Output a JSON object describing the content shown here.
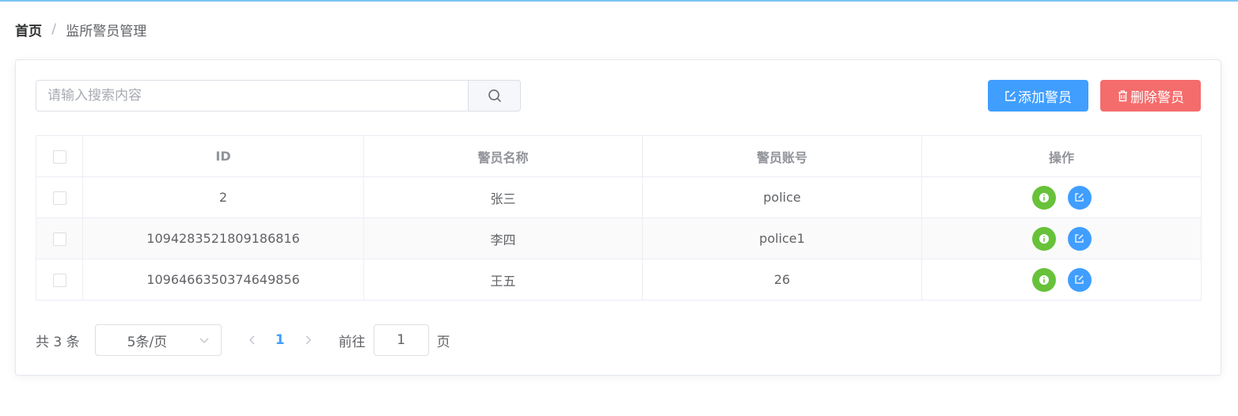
{
  "breadcrumb": {
    "home": "首页",
    "separator": "/",
    "current": "监所警员管理"
  },
  "toolbar": {
    "search_placeholder": "请输入搜索内容",
    "add_label": "添加警员",
    "delete_label": "删除警员"
  },
  "table": {
    "headers": {
      "id": "ID",
      "name": "警员名称",
      "account": "警员账号",
      "actions": "操作"
    },
    "rows": [
      {
        "id": "2",
        "name": "张三",
        "account": "police"
      },
      {
        "id": "1094283521809186816",
        "name": "李四",
        "account": "police1"
      },
      {
        "id": "1096466350374649856",
        "name": "王五",
        "account": "26"
      }
    ]
  },
  "pagination": {
    "total": "共 3 条",
    "page_size": "5条/页",
    "current_page": "1",
    "goto_label": "前往",
    "goto_value": "1",
    "goto_suffix": "页"
  },
  "colors": {
    "primary": "#409eff",
    "danger": "#f56c6c",
    "success": "#67c23a"
  },
  "icons": {
    "search": "search-icon",
    "add": "edit-icon",
    "delete": "trash-icon",
    "detail": "info-icon",
    "edit": "edit-icon",
    "dropdown": "chevron-down-icon",
    "prev": "chevron-left-icon",
    "next": "chevron-right-icon"
  }
}
